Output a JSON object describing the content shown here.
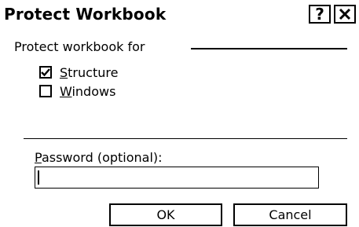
{
  "window": {
    "title": "Protect Workbook",
    "help_label": "?",
    "close_icon": "close-icon"
  },
  "group": {
    "label": "Protect workbook for"
  },
  "options": {
    "structure": {
      "mnemonic": "S",
      "rest": "tructure",
      "checked": true
    },
    "windows": {
      "mnemonic": "W",
      "rest": "indows",
      "checked": false
    }
  },
  "password": {
    "label_mnemonic": "P",
    "label_rest": "assword (optional):",
    "value": ""
  },
  "buttons": {
    "ok_label": "OK",
    "cancel_label": "Cancel"
  }
}
